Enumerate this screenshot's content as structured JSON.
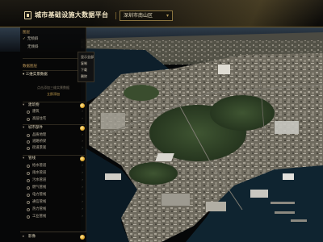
{
  "header": {
    "title": "城市基础设施大数据平台",
    "location": "深圳市南山区",
    "location_arrow": "▾"
  },
  "sidebar": {
    "section1_label": "图层",
    "section1_items": [
      {
        "label": "无倾斜",
        "checked": true
      },
      {
        "label": "无倾斜",
        "checked": false
      }
    ],
    "section2_label": "数据图层",
    "panel_title": "三维实景数据",
    "empty_hint": "点击添加三维实景数据",
    "add_link": "立即添加",
    "groups": [
      {
        "name": "建筑物",
        "layers": [
          "建筑",
          "高层住宅"
        ]
      },
      {
        "name": "城市部件",
        "layers": [
          "品质地理",
          "道路桥梁",
          "街道景观"
        ]
      },
      {
        "name": "管线",
        "layers": [
          "给水管道",
          "雨水管道",
          "污水管道",
          "燃气管线",
          "电力管线",
          "通信管线",
          "热力管线",
          "工业管线"
        ]
      }
    ],
    "bottom_group": "影像",
    "more_glyph": "›"
  },
  "dropdown": {
    "items": [
      "显示全部",
      "复制",
      "下载",
      "删除"
    ]
  }
}
